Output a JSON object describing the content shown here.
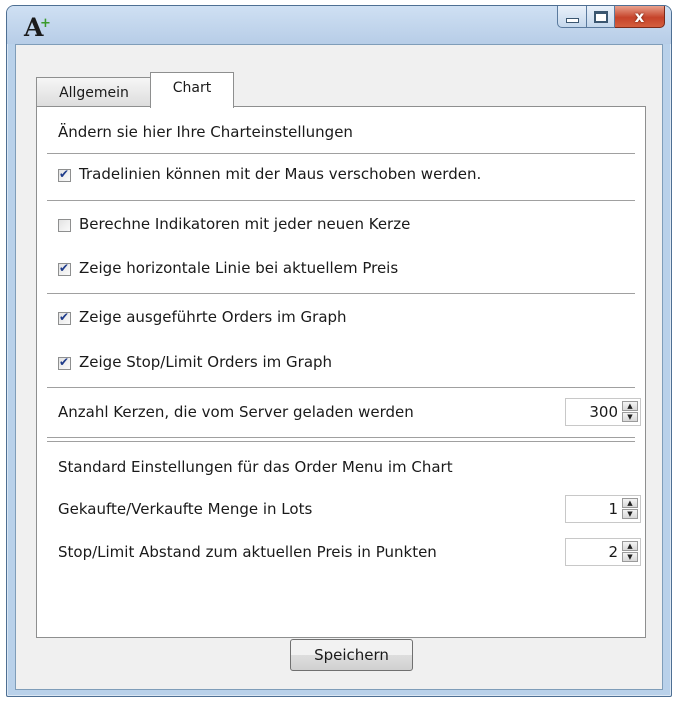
{
  "window": {
    "app_icon": "app-logo-A-icon",
    "caption_buttons": {
      "minimize": "minimize-icon",
      "maximize": "maximize-icon",
      "close_label": "x"
    }
  },
  "tabs": [
    {
      "label": "Allgemein",
      "active": false
    },
    {
      "label": "Chart",
      "active": true
    }
  ],
  "chart_panel": {
    "heading": "Ändern sie hier Ihre Charteinstellungen",
    "options": [
      {
        "label": "Tradelinien können mit der Maus verschoben werden.",
        "checked": true
      },
      {
        "label": "Berechne Indikatoren mit jeder neuen Kerze",
        "checked": false
      },
      {
        "label": "Zeige horizontale Linie bei aktuellem Preis",
        "checked": true
      },
      {
        "label": "Zeige ausgeführte Orders im Graph",
        "checked": true
      },
      {
        "label": "Zeige Stop/Limit Orders im Graph",
        "checked": true
      }
    ],
    "candles": {
      "label": "Anzahl Kerzen, die vom Server geladen werden",
      "value": "300"
    },
    "order_menu": {
      "heading": "Standard Einstellungen für das Order Menu im Chart",
      "lots": {
        "label": "Gekaufte/Verkaufte Menge in Lots",
        "value": "1"
      },
      "distance": {
        "label": "Stop/Limit Abstand zum aktuellen Preis in Punkten",
        "value": "2"
      }
    }
  },
  "footer": {
    "save_label": "Speichern"
  },
  "colors": {
    "title_bar": "#b9d1ea",
    "close_button": "#c6432a",
    "checkmark": "#1e3b8a"
  }
}
